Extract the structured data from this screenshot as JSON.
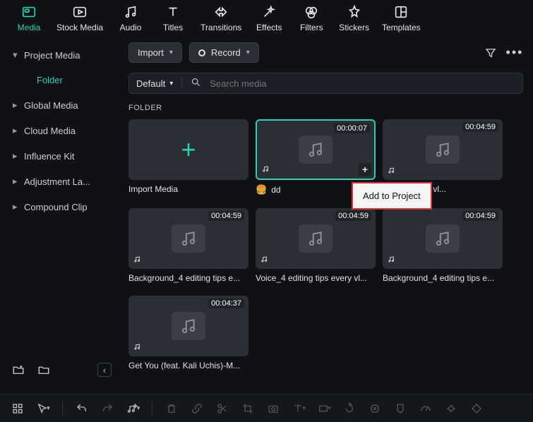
{
  "tabs": [
    {
      "id": "media",
      "label": "Media"
    },
    {
      "id": "stock",
      "label": "Stock Media"
    },
    {
      "id": "audio",
      "label": "Audio"
    },
    {
      "id": "titles",
      "label": "Titles"
    },
    {
      "id": "transitions",
      "label": "Transitions"
    },
    {
      "id": "effects",
      "label": "Effects"
    },
    {
      "id": "filters",
      "label": "Filters"
    },
    {
      "id": "stickers",
      "label": "Stickers"
    },
    {
      "id": "templates",
      "label": "Templates"
    }
  ],
  "sidebar": {
    "items": [
      {
        "label": "Project Media",
        "expanded": true
      },
      {
        "label": "Folder",
        "sub": true
      },
      {
        "label": "Global Media"
      },
      {
        "label": "Cloud Media"
      },
      {
        "label": "Influence Kit"
      },
      {
        "label": "Adjustment La..."
      },
      {
        "label": "Compound Clip"
      }
    ]
  },
  "toolbar": {
    "import": "Import",
    "record": "Record"
  },
  "search": {
    "sort": "Default",
    "placeholder": "Search media"
  },
  "section_title": "FOLDER",
  "cards": [
    {
      "type": "import",
      "caption": "Import Media"
    },
    {
      "type": "audio",
      "duration": "00:00:07",
      "caption": "dd",
      "selected": true,
      "show_plus": true,
      "show_emoji": true
    },
    {
      "type": "audio",
      "duration": "00:04:59",
      "caption": "ng tips every vl..."
    },
    {
      "type": "audio",
      "duration": "00:04:59",
      "caption": "Background_4 editing tips e..."
    },
    {
      "type": "audio",
      "duration": "00:04:59",
      "caption": "Voice_4 editing tips every vl..."
    },
    {
      "type": "audio",
      "duration": "00:04:59",
      "caption": "Background_4 editing tips e..."
    },
    {
      "type": "audio",
      "duration": "00:04:37",
      "caption": "Get You (feat. Kali Uchis)-M..."
    }
  ],
  "tooltip": "Add to Project"
}
